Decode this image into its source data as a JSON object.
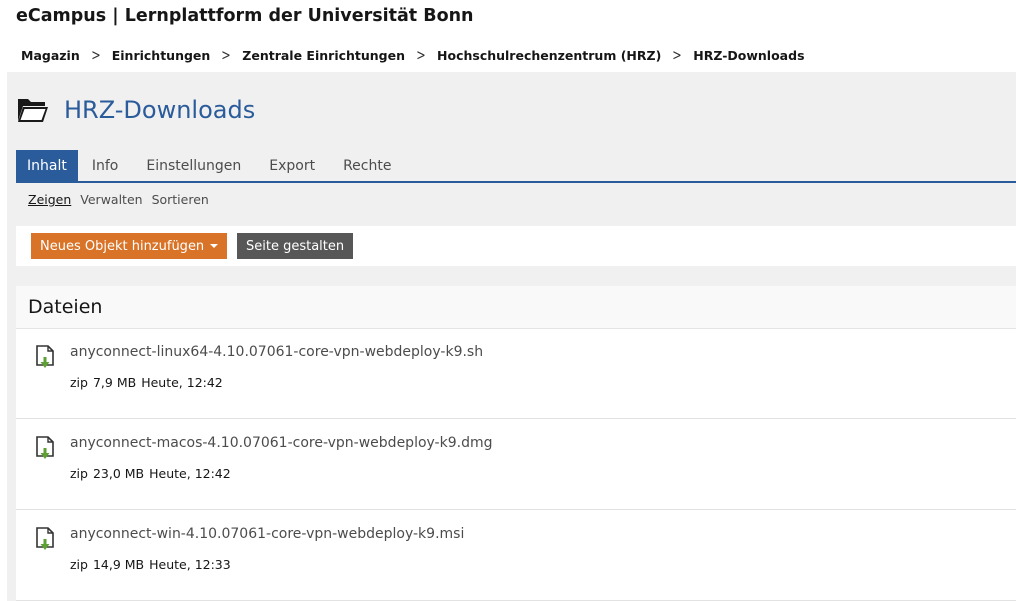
{
  "site_title": "eCampus | Lernplattform der Universität Bonn",
  "breadcrumb": {
    "items": [
      "Magazin",
      "Einrichtungen",
      "Zentrale Einrichtungen",
      "Hochschulrechenzentrum (HRZ)",
      "HRZ-Downloads"
    ],
    "separator": ">"
  },
  "page": {
    "title": "HRZ-Downloads",
    "icon": "folder-open-icon"
  },
  "tabs": [
    {
      "label": "Inhalt",
      "active": true
    },
    {
      "label": "Info",
      "active": false
    },
    {
      "label": "Einstellungen",
      "active": false
    },
    {
      "label": "Export",
      "active": false
    },
    {
      "label": "Rechte",
      "active": false
    }
  ],
  "subtabs": [
    {
      "label": "Zeigen",
      "active": true
    },
    {
      "label": "Verwalten",
      "active": false
    },
    {
      "label": "Sortieren",
      "active": false
    }
  ],
  "toolbar": {
    "add_label": "Neues Objekt hinzufügen",
    "layout_label": "Seite gestalten"
  },
  "files_block": {
    "title": "Dateien",
    "items": [
      {
        "name": "anyconnect-linux64-4.10.07061-core-vpn-webdeploy-k9.sh",
        "type": "zip",
        "size": "7,9 MB",
        "date": "Heute, 12:42",
        "icon": "file-download-icon"
      },
      {
        "name": "anyconnect-macos-4.10.07061-core-vpn-webdeploy-k9.dmg",
        "type": "zip",
        "size": "23,0 MB",
        "date": "Heute, 12:42",
        "icon": "file-download-icon"
      },
      {
        "name": "anyconnect-win-4.10.07061-core-vpn-webdeploy-k9.msi",
        "type": "zip",
        "size": "14,9 MB",
        "date": "Heute, 12:33",
        "icon": "file-download-icon"
      }
    ]
  },
  "colors": {
    "accent_blue": "#2a5b9a",
    "primary_orange": "#d87327",
    "default_gray": "#575757",
    "download_green": "#5fa035"
  }
}
